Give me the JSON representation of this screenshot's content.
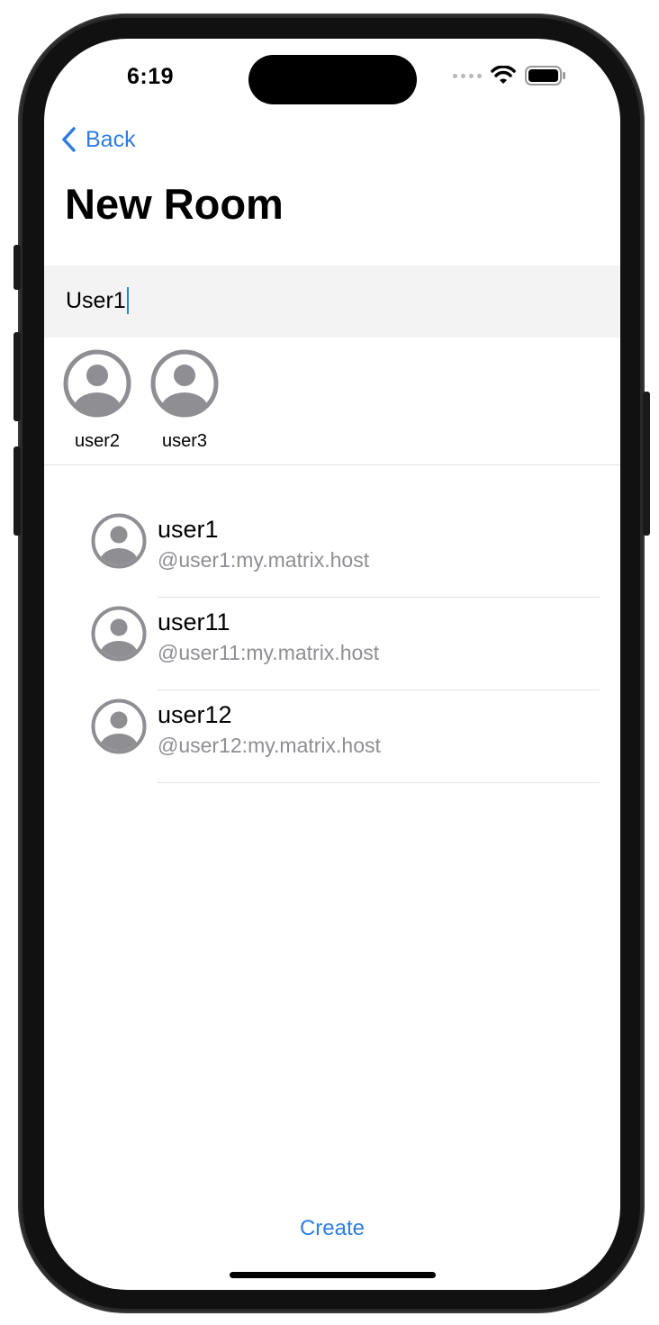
{
  "status_bar": {
    "time": "6:19"
  },
  "nav": {
    "back_label": "Back",
    "title": "New Room"
  },
  "search": {
    "value": "User1"
  },
  "selected_users": [
    {
      "label": "user2"
    },
    {
      "label": "user3"
    }
  ],
  "results": [
    {
      "name": "user1",
      "id": "@user1:my.matrix.host"
    },
    {
      "name": "user11",
      "id": "@user11:my.matrix.host"
    },
    {
      "name": "user12",
      "id": "@user12:my.matrix.host"
    }
  ],
  "actions": {
    "create_label": "Create"
  },
  "colors": {
    "accent": "#2f7de1",
    "avatar_gray": "#8e8e93",
    "search_bg": "#f3f3f3"
  },
  "icons": {
    "back": "chevron-left-icon",
    "avatar": "person-circle-icon",
    "wifi": "wifi-icon",
    "battery": "battery-icon"
  }
}
